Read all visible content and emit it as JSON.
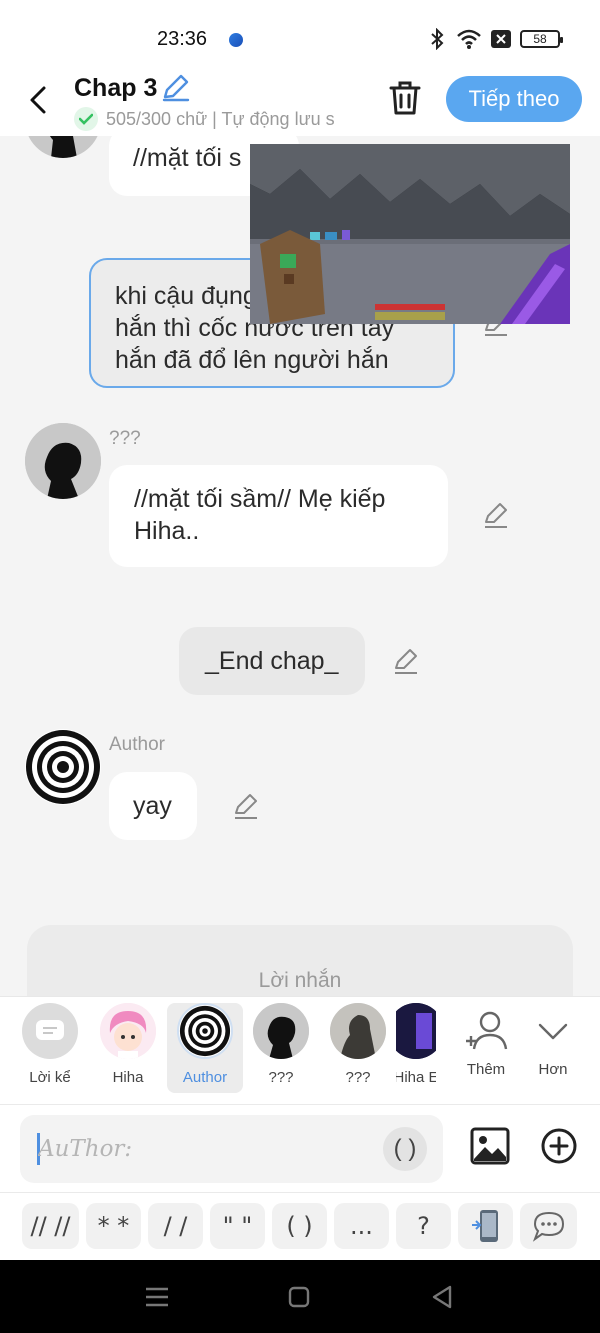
{
  "status_bar": {
    "time": "23:36",
    "battery": "58"
  },
  "header": {
    "title": "Chap 3",
    "word_count": "505/300 chữ | Tự động lưu s",
    "next_label": "Tiếp theo"
  },
  "messages": [
    {
      "text": "//mặt tối s"
    },
    {
      "text_lines": [
        "khi cậu đụng",
        "hắn thì cốc nước trên tay",
        "hắn đã đổ lên người hắn"
      ]
    },
    {
      "speaker": "???",
      "text_lines": [
        "//mặt tối sầm// Mẹ kiếp",
        "Hiha.."
      ]
    },
    {
      "text": "_End chap_"
    },
    {
      "speaker": "Author",
      "text": "yay"
    }
  ],
  "note_label": "Lời nhắn",
  "characters": [
    {
      "label": "Lời kể"
    },
    {
      "label": "Hiha"
    },
    {
      "label": "Author",
      "selected": true
    },
    {
      "label": "???"
    },
    {
      "label": "???"
    },
    {
      "label": "Hiha E"
    },
    {
      "label": "Thêm"
    },
    {
      "label": "Hơn"
    }
  ],
  "input": {
    "placeholder": "AuThor:",
    "paren_button": "( )"
  },
  "chips": [
    "// //",
    "* *",
    "/ /",
    "\" \"",
    "( )",
    "...",
    "?"
  ],
  "colors": {
    "accent": "#5aa7f0",
    "selected_label": "#4e8fe0",
    "selected_border": "#cfdff2"
  }
}
